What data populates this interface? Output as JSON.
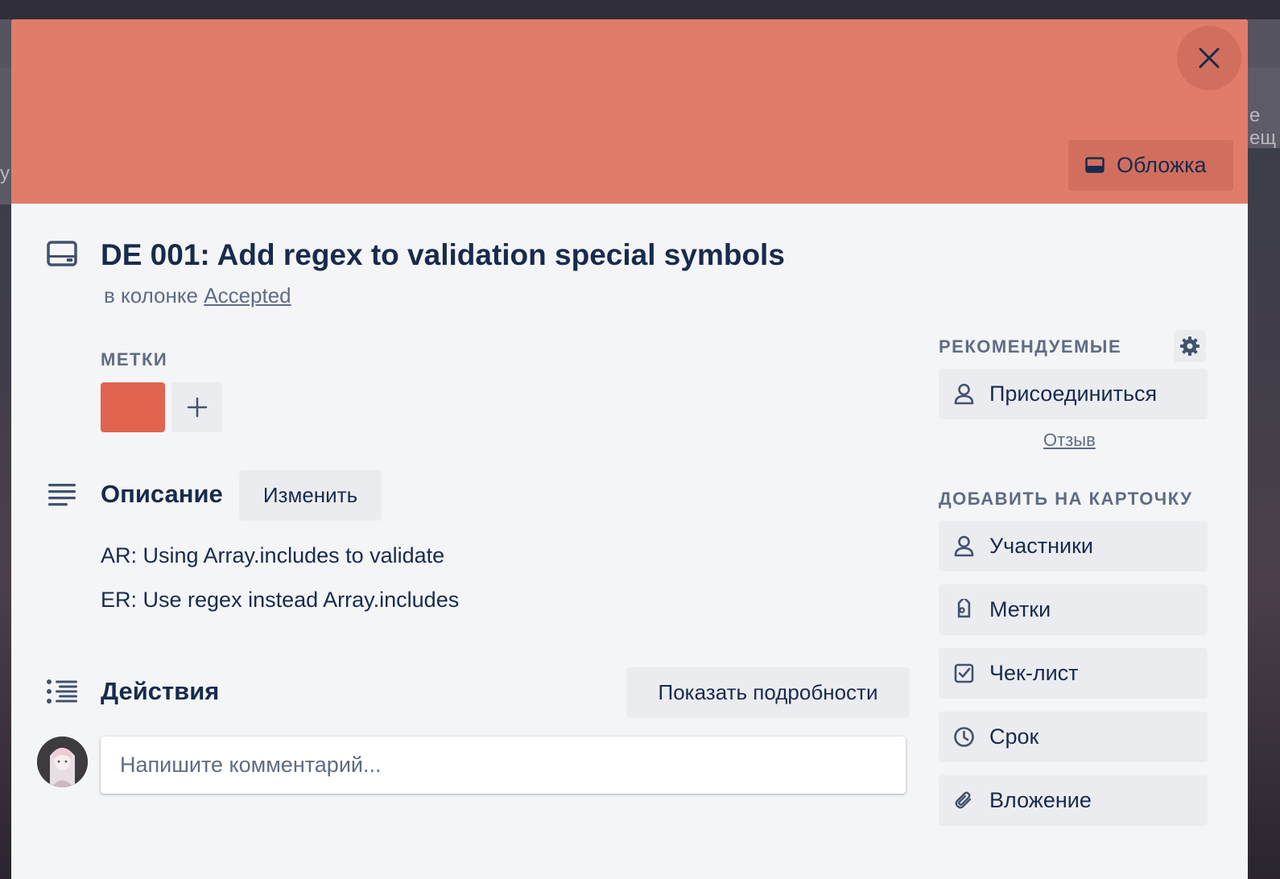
{
  "background": {
    "right_text": "е ещ",
    "left_text": "у"
  },
  "cover": {
    "color": "#e17c6a",
    "button_label": "Обложка"
  },
  "card": {
    "title": "DE 001: Add regex to validation special symbols",
    "in_list_prefix": "в колонке",
    "list_name": "Accepted"
  },
  "labels": {
    "heading": "Метки",
    "items": [
      {
        "color": "#e06450"
      }
    ]
  },
  "description": {
    "heading": "Описание",
    "edit_label": "Изменить",
    "lines": [
      "AR: Using Array.includes to validate",
      "ER: Use regex instead Array.includes"
    ]
  },
  "activity": {
    "heading": "Действия",
    "show_details_label": "Показать подробности",
    "comment_placeholder": "Напишите комментарий..."
  },
  "sidebar": {
    "suggested_heading": "Рекомендуемые",
    "join_label": "Присоединиться",
    "feedback_label": "Отзыв",
    "add_heading": "Добавить на карточку",
    "add_items": [
      {
        "label": "Участники",
        "icon": "person-icon"
      },
      {
        "label": "Метки",
        "icon": "tag-icon"
      },
      {
        "label": "Чек-лист",
        "icon": "checklist-icon"
      },
      {
        "label": "Срок",
        "icon": "clock-icon"
      },
      {
        "label": "Вложение",
        "icon": "paperclip-icon"
      }
    ]
  }
}
